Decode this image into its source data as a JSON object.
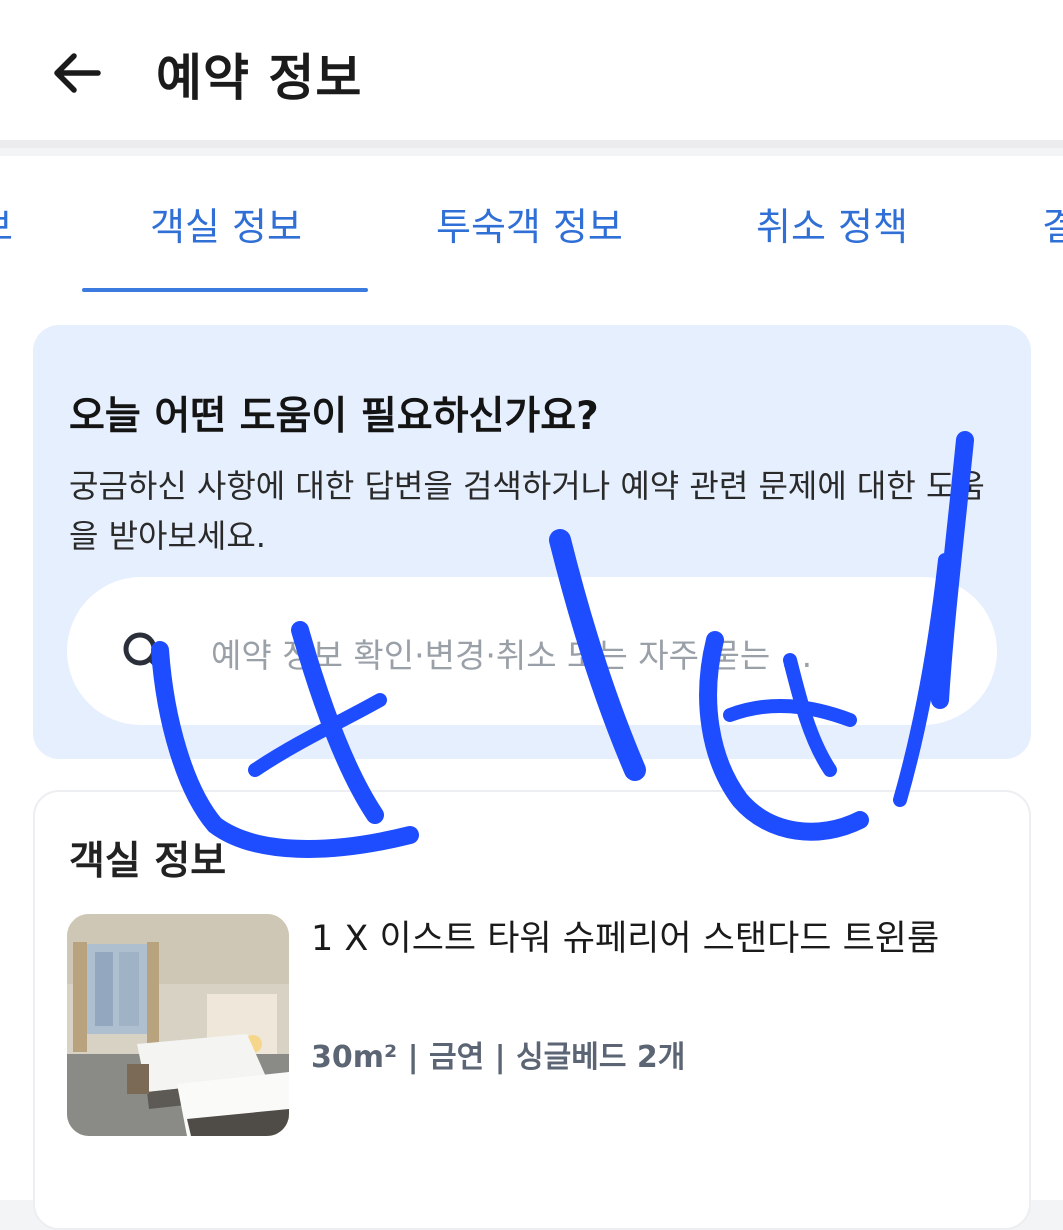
{
  "header": {
    "back_icon": "arrow-left-icon",
    "title": "예약 정보"
  },
  "tabs": [
    {
      "label": "보"
    },
    {
      "label": "객실 정보",
      "active": true
    },
    {
      "label": "투숙객 정보"
    },
    {
      "label": "취소 정책"
    },
    {
      "label": "결"
    }
  ],
  "help": {
    "title": "오늘 어떤 도움이 필요하신가요?",
    "description": "궁금하신 사항에 대한 답변을 검색하거나 예약 관련 문제에 대한 도움을 받아보세요.",
    "search": {
      "icon": "search-icon",
      "placeholder": "예약 정보 확인·변경·취소 또는 자주 묻는 ..."
    }
  },
  "room_info": {
    "section_title": "객실 정보",
    "room_name": "1 X 이스트 타워 슈페리어 스탠다드 트윈룸",
    "meta": "30m² | 금연 | 싱글베드 2개"
  },
  "colors": {
    "accent": "#2f6fd6",
    "help_bg": "#e6effd",
    "scribble": "#1e4cff"
  }
}
